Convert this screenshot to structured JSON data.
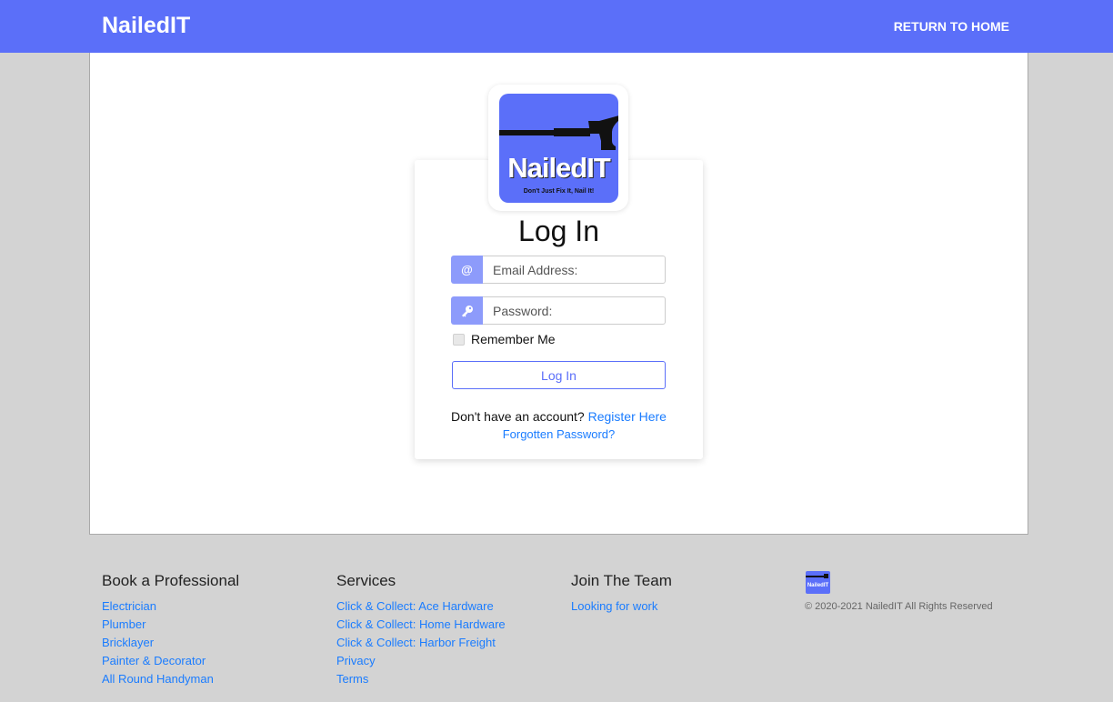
{
  "header": {
    "brand": "NailedIT",
    "return_home": "RETURN TO HOME"
  },
  "logo": {
    "word": "NailedIT",
    "slogan": "Don't Just Fix It, Nail It!",
    "icon": "hammer-icon"
  },
  "login": {
    "title": "Log In",
    "email_icon": "at-sign-icon",
    "email_placeholder": "Email Address:",
    "password_icon": "key-icon",
    "password_placeholder": "Password:",
    "remember_label": "Remember Me",
    "button_label": "Log In",
    "no_account_text": "Don't have an account?",
    "register_link": "Register Here",
    "forgot_link": "Forgotten Password?"
  },
  "footer": {
    "col1": {
      "heading": "Book a Professional",
      "links": [
        "Electrician",
        "Plumber",
        "Bricklayer",
        "Painter & Decorator",
        "All Round Handyman"
      ]
    },
    "col2": {
      "heading": "Services",
      "links": [
        "Click & Collect: Ace Hardware",
        "Click & Collect: Home Hardware",
        "Click & Collect: Harbor Freight",
        "Privacy",
        "Terms"
      ]
    },
    "col3": {
      "heading": "Join The Team",
      "links": [
        "Looking for work"
      ]
    },
    "logo_word": "NailedIT",
    "copyright": "© 2020-2021 NailedIT All Rights Reserved"
  },
  "colors": {
    "brand": "#5b6ff9",
    "addon": "#8d9bfb",
    "link": "#1a7cff",
    "background": "#d3d3d3"
  }
}
